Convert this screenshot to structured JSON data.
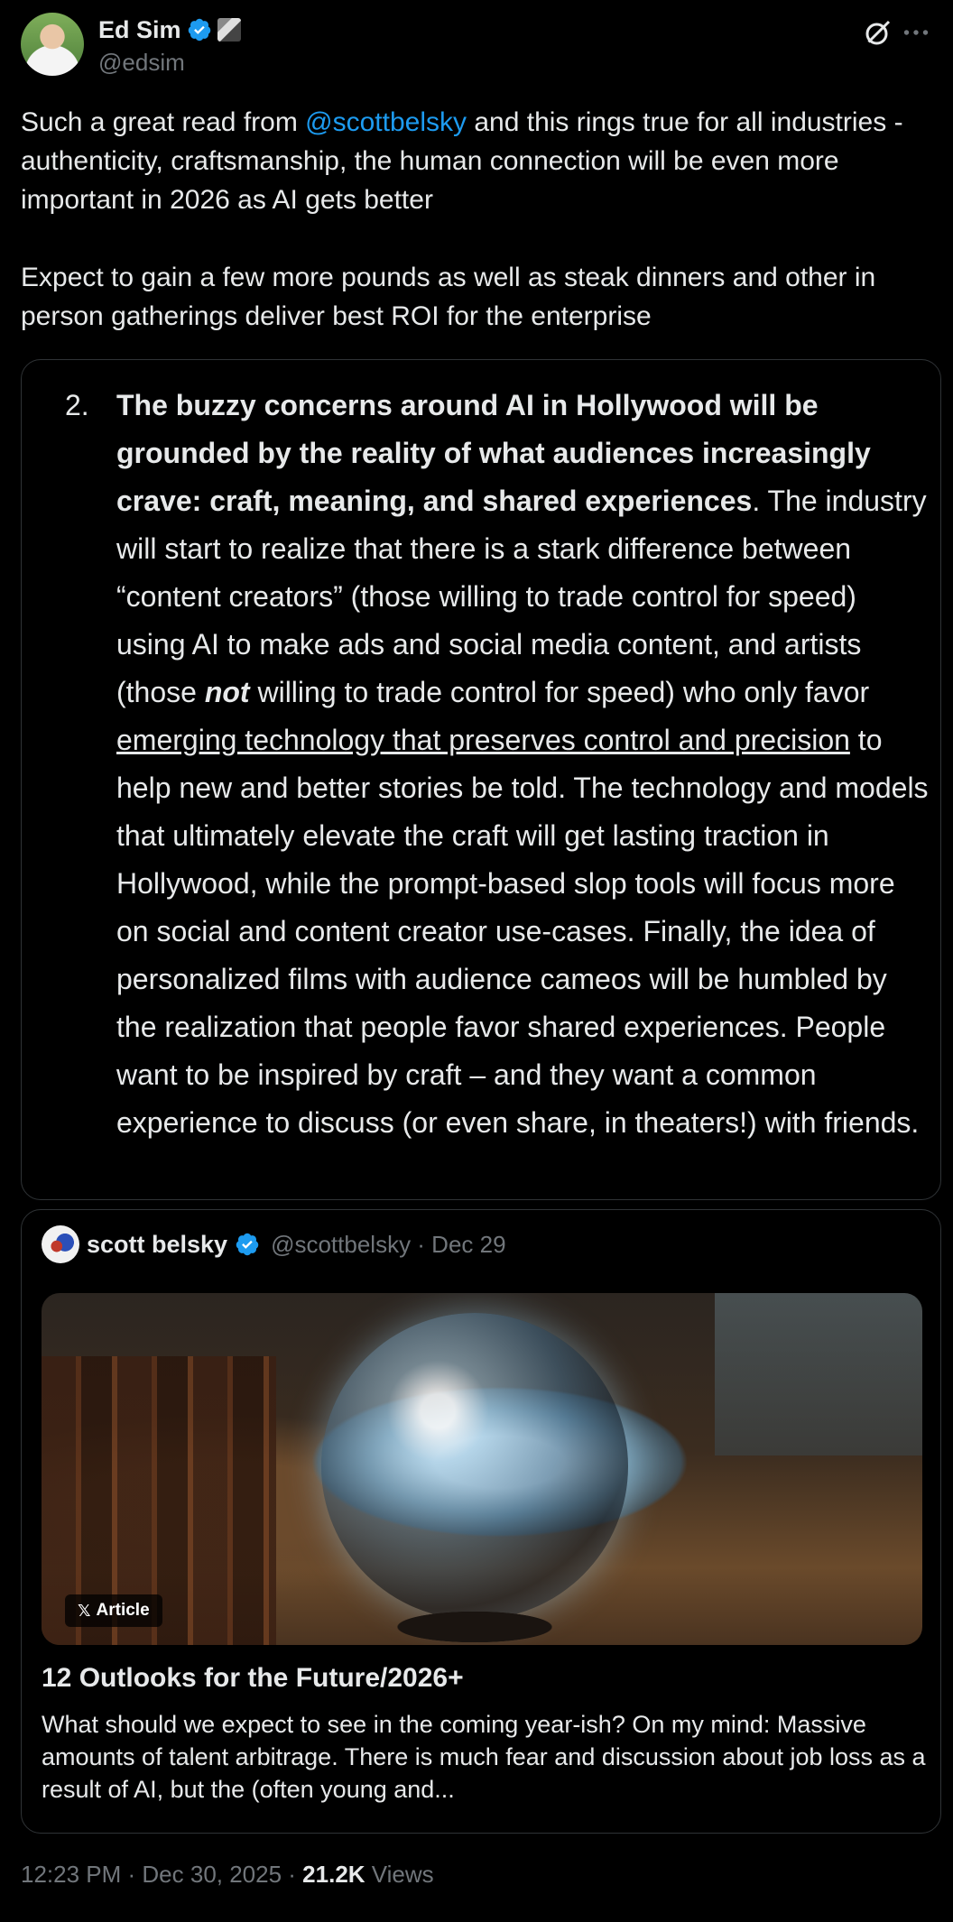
{
  "author": {
    "display_name": "Ed Sim",
    "handle": "@edsim"
  },
  "tweet": {
    "text_p1_before": "Such a great read from ",
    "mention": "@scottbelsky",
    "text_p1_after": " and this rings true for all industries - authenticity, craftsmanship, the human connection will be even more important in 2026 as AI gets better",
    "text_p2": "Expect to gain a few more pounds as well as steak dinners and other in person gatherings deliver best ROI for the enterprise"
  },
  "attached_image": {
    "list_number": "2.",
    "bold_lead": "The buzzy concerns around AI in Hollywood will be grounded by the reality of what audiences increasingly crave: craft, meaning, and shared experiences",
    "seg1": ". The industry will start to realize that there is a stark difference between “content creators” (those willing to trade control for speed) using AI to make ads and social media content, and artists (those ",
    "italic_word": "not",
    "seg2": " willing to trade control for speed) who only favor ",
    "link_text": "emerging technology that preserves control and precision",
    "seg3": " to help new and better stories be told. The technology and models that ultimately elevate the craft will get lasting traction in Hollywood, while the prompt-based slop tools will focus more on social and content creator use-cases. Finally, the idea of personalized films with audience cameos will be humbled by the realization that people favor shared experiences. People want to be inspired by craft – and they want a common experience to discuss (or even share, in theaters!) with friends."
  },
  "quoted_post": {
    "display_name": "scott belsky",
    "handle_date": "@scottbelsky · Dec 29",
    "article_badge": "Article",
    "article_title": "12 Outlooks for the Future/2026+",
    "article_excerpt": "What should we expect to see in the coming year-ish? On my mind: Massive amounts of talent arbitrage. There is much fear and discussion about job loss as a result of AI, but the (often young and..."
  },
  "meta": {
    "timestamp": "12:23 PM · Dec 30, 2025 · ",
    "views_count": "21.2K",
    "views_label": " Views"
  },
  "colors": {
    "background": "#000000",
    "text": "#e7e9ea",
    "muted": "#71767b",
    "accent": "#1d9bf0",
    "border": "#2f3336"
  },
  "icons": [
    "verified-badge-icon",
    "grok-icon",
    "more-icon",
    "x-logo-icon"
  ]
}
